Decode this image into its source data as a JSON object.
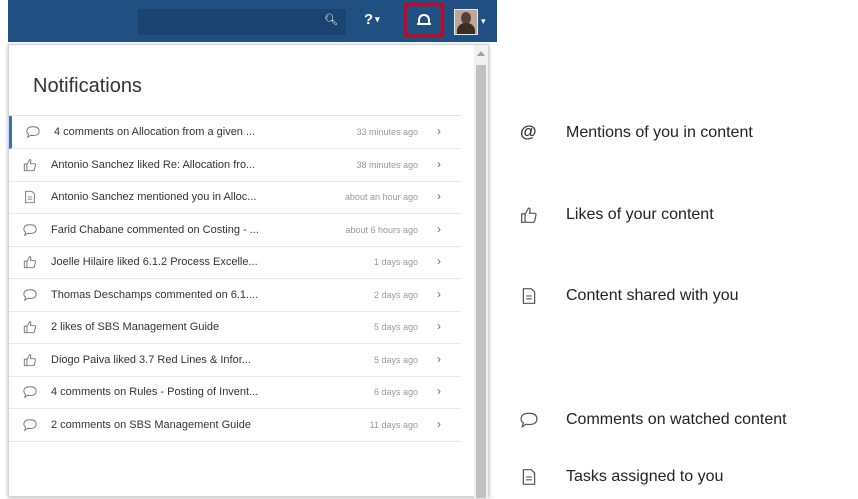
{
  "panel": {
    "title": "Notifications"
  },
  "notifications": [
    {
      "icon": "comment-icon",
      "text": "4 comments on Allocation from a given ...",
      "time": "33 minutes ago",
      "active": true
    },
    {
      "icon": "like-icon",
      "text": "Antonio Sanchez liked Re: Allocation fro...",
      "time": "38 minutes ago"
    },
    {
      "icon": "page-icon",
      "text": "Antonio Sanchez mentioned you in Alloc...",
      "time": "about an hour ago"
    },
    {
      "icon": "comment-icon",
      "text": "Farid Chabane commented on Costing - ...",
      "time": "about 6 hours ago"
    },
    {
      "icon": "like-icon",
      "text": "Joelle Hilaire liked 6.1.2 Process Excelle...",
      "time": "1 days ago"
    },
    {
      "icon": "comment-icon",
      "text": "Thomas Deschamps commented on 6.1....",
      "time": "2 days ago"
    },
    {
      "icon": "like-icon",
      "text": "2 likes of SBS Management Guide",
      "time": "5 days ago"
    },
    {
      "icon": "like-icon",
      "text": "Diogo Paiva liked 3.7 Red Lines & Infor...",
      "time": "5 days ago"
    },
    {
      "icon": "comment-icon",
      "text": "4 comments on Rules - Posting of Invent...",
      "time": "6 days ago"
    },
    {
      "icon": "comment-icon",
      "text": "2 comments on SBS Management Guide",
      "time": "11 days ago"
    }
  ],
  "legend": {
    "mentions": "Mentions of you in content",
    "mentions_symbol": "@",
    "likes": "Likes of your content",
    "shared": "Content shared with you",
    "comments": "Comments on watched content",
    "tasks": "Tasks assigned to you"
  }
}
